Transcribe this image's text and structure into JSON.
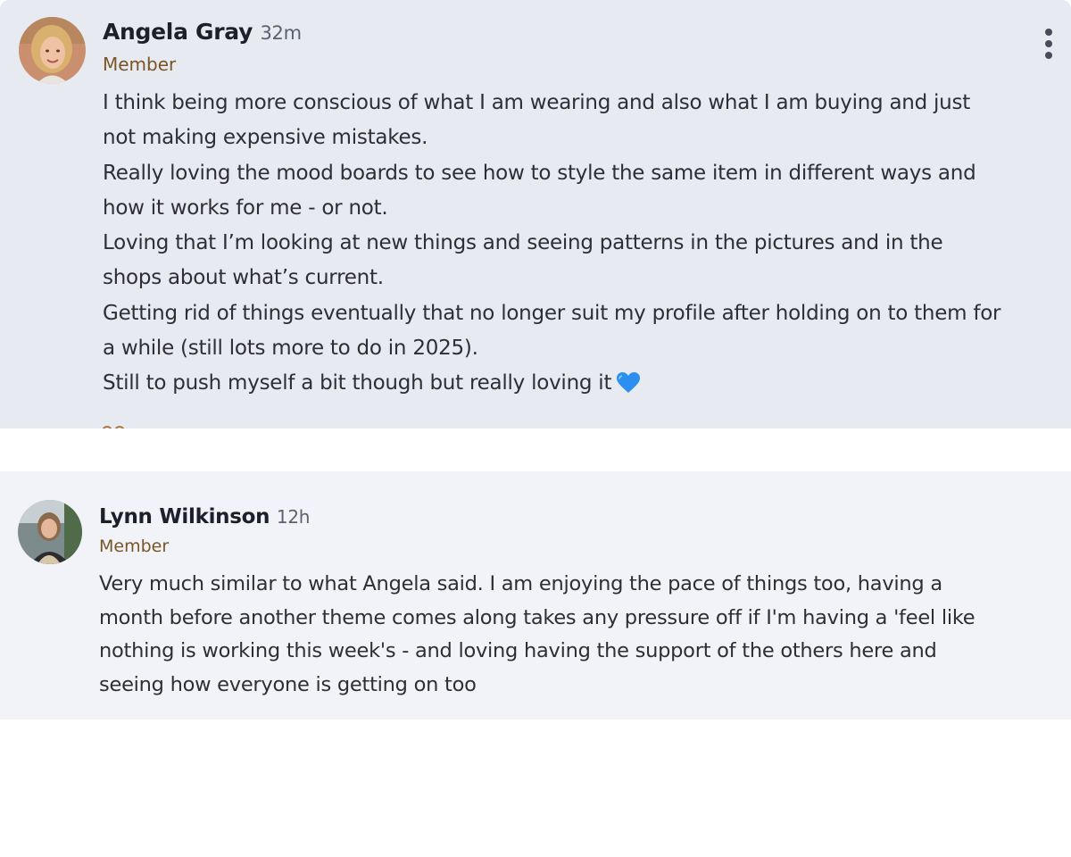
{
  "comments": [
    {
      "author": "Angela Gray",
      "time": "32m",
      "role": "Member",
      "lines": [
        "I think being more conscious of what I am wearing and also what I am buying and just",
        "not making expensive mistakes.",
        "Really loving the mood boards to see how to style the same item in different ways and",
        "how it works for me - or not.",
        "Loving that I’m looking at new things and seeing patterns in the pictures and in the",
        "shops about what’s current.",
        "Getting rid of things eventually that no longer suit my profile after holding on to them for",
        "a while (still lots more to do in 2025).",
        "Still to push myself a bit though but really loving it"
      ],
      "trailing_emoji": "blue-heart-emoji",
      "menu_icon": "more-vertical-icon"
    },
    {
      "author": "Lynn Wilkinson",
      "time": "12h",
      "role": "Member",
      "lines": [
        "Very much similar to what Angela said. I am enjoying the pace of things too, having a",
        "month before another theme comes along takes any pressure off if I'm having a 'feel like",
        "nothing is working this week's - and loving having the support of the others here and",
        "seeing how everyone is getting on too"
      ]
    }
  ],
  "colors": {
    "card1_bg": "#e8eaf1",
    "card2_bg": "#f2f3f8",
    "role_color": "#7a5526",
    "name_color": "#1d1f2a"
  }
}
